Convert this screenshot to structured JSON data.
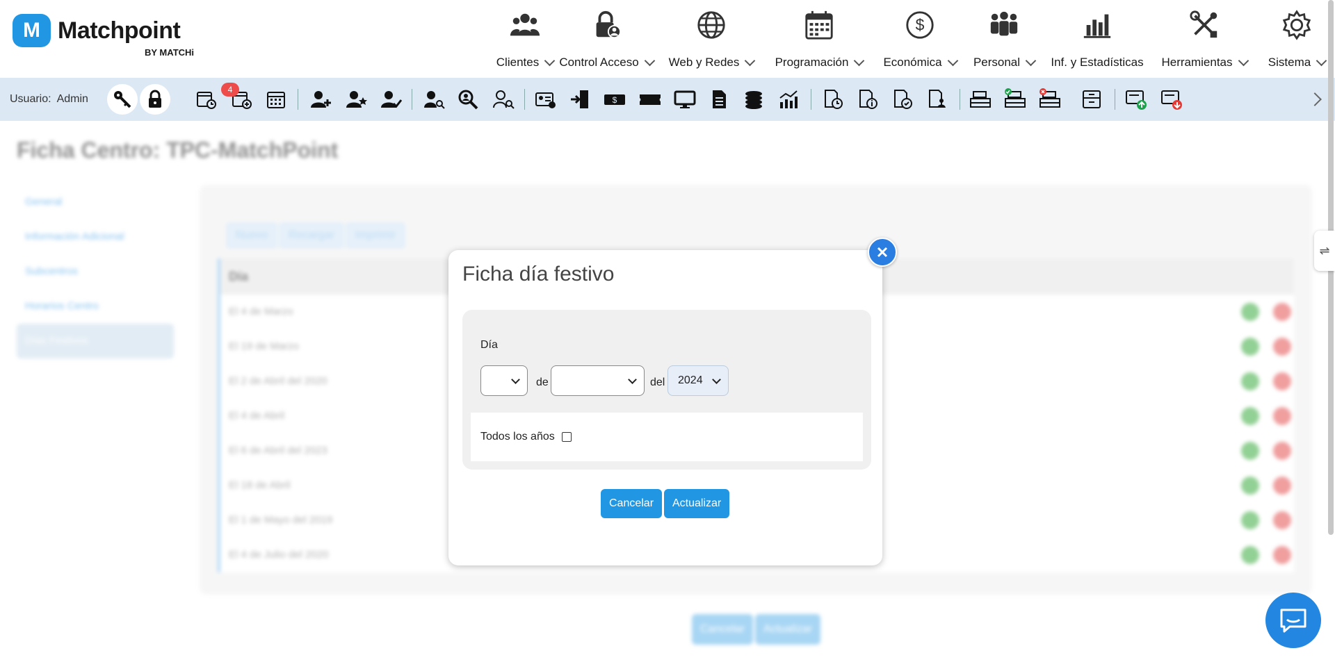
{
  "brand": {
    "name": "Matchpoint",
    "badge": "M",
    "sub": "BY MATCHi"
  },
  "nav": [
    {
      "label": "Clientes",
      "icon": "users-group-icon"
    },
    {
      "label": "Control Acceso",
      "icon": "lock-user-icon"
    },
    {
      "label": "Web y Redes",
      "icon": "globe-icon"
    },
    {
      "label": "Programación",
      "icon": "calendar-icon"
    },
    {
      "label": "Económica",
      "icon": "dollar-icon"
    },
    {
      "label": "Personal",
      "icon": "staff-icon"
    },
    {
      "label": "Inf. y Estadísticas",
      "icon": "bar-chart-icon"
    },
    {
      "label": "Herramientas",
      "icon": "tools-icon"
    },
    {
      "label": "Sistema",
      "icon": "gear-icon"
    }
  ],
  "toolbar": {
    "user_prefix": "Usuario:",
    "user_name": "Admin",
    "notification_count": "4"
  },
  "page": {
    "title": "Ficha Centro: TPC-MatchPoint",
    "side_menu": [
      "General",
      "Información Adicional",
      "Subcentros",
      "Horarios Centro",
      "Días Festivos"
    ],
    "panel_buttons": [
      "Nuevo",
      "Recargar",
      "Imprimir"
    ],
    "table_header": "Día",
    "rows": [
      "El 4 de Marzo",
      "El 19 de Marzo",
      "El 2 de Abril del 2020",
      "El 4 de Abril",
      "El 6 de Abril del 2023",
      "El 18 de Abril",
      "El 1 de Mayo del 2019",
      "El 4 de Julio del 2020"
    ],
    "bottom_cancel": "Cancelar",
    "bottom_update": "Actualizar"
  },
  "modal": {
    "title": "Ficha día festivo",
    "field_label": "Día",
    "day_value": "",
    "word_de": "de",
    "month_value": "",
    "word_del": "del",
    "year_value": "2024",
    "todos_label": "Todos los años",
    "cancel": "Cancelar",
    "update": "Actualizar"
  },
  "colors": {
    "primary": "#2196e3",
    "toolbar_bg": "#dce9f5",
    "close": "#2a7de1"
  }
}
